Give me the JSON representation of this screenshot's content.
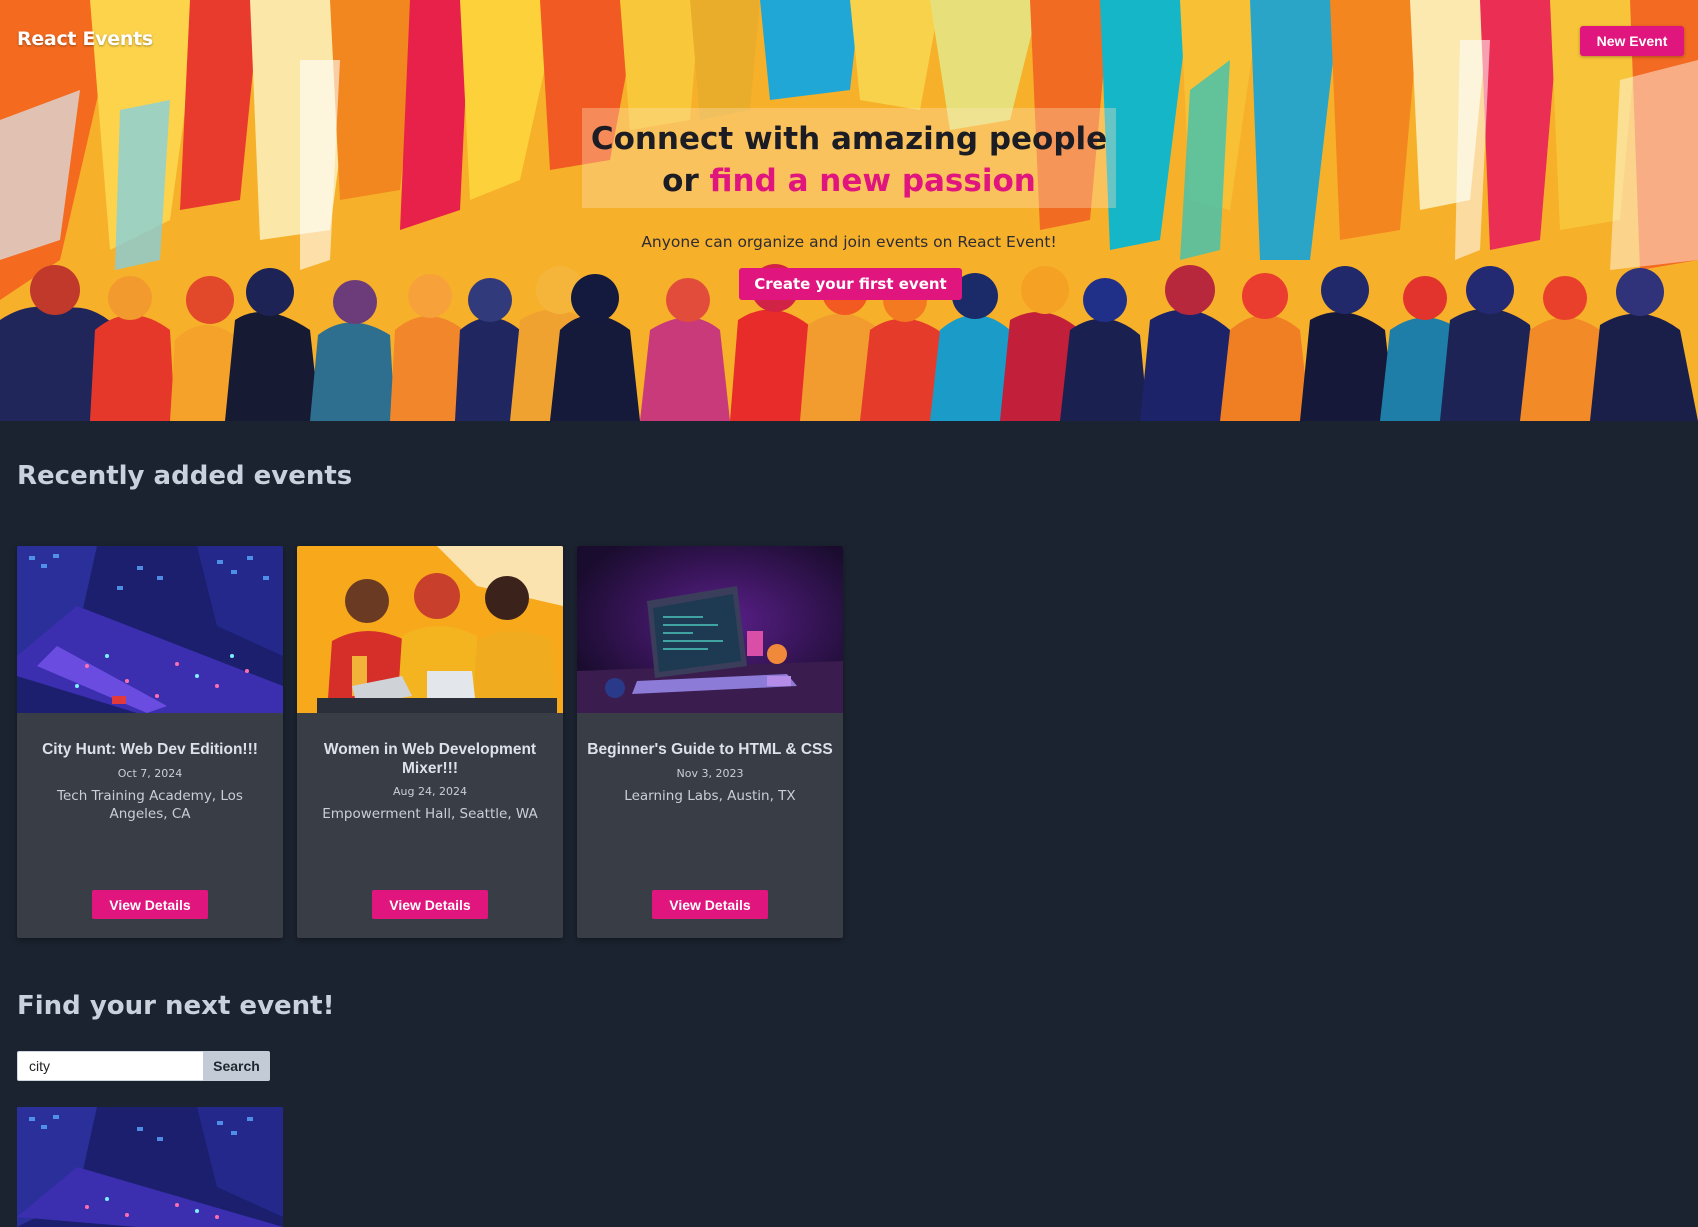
{
  "header": {
    "brand": "React Events",
    "new_event_label": "New Event"
  },
  "hero": {
    "title_line1": "Connect with amazing people",
    "title_line2_prefix": "or ",
    "title_line2_accent": "find a new passion",
    "subtitle": "Anyone can organize and join events on React Event!",
    "cta_label": "Create your first event"
  },
  "recent": {
    "title": "Recently added events",
    "events": [
      {
        "title": "City Hunt: Web Dev Edition!!!",
        "date": "Oct 7, 2024",
        "location": "Tech Training Academy, Los Angeles, CA",
        "button": "View Details",
        "image": "isometric-city-night-image"
      },
      {
        "title": "Women in Web Development Mixer!!!",
        "date": "Aug 24, 2024",
        "location": "Empowerment Hall, Seattle, WA",
        "button": "View Details",
        "image": "women-with-laptops-image"
      },
      {
        "title": "Beginner's Guide to HTML & CSS",
        "date": "Nov 3, 2023",
        "location": "Learning Labs, Austin, TX",
        "button": "View Details",
        "image": "laptop-desk-night-image"
      }
    ]
  },
  "search": {
    "title": "Find your next event!",
    "value": "city",
    "button": "Search"
  },
  "colors": {
    "page_bg": "#1b2330",
    "accent": "#e0157e",
    "card_bg": "#393e46"
  }
}
